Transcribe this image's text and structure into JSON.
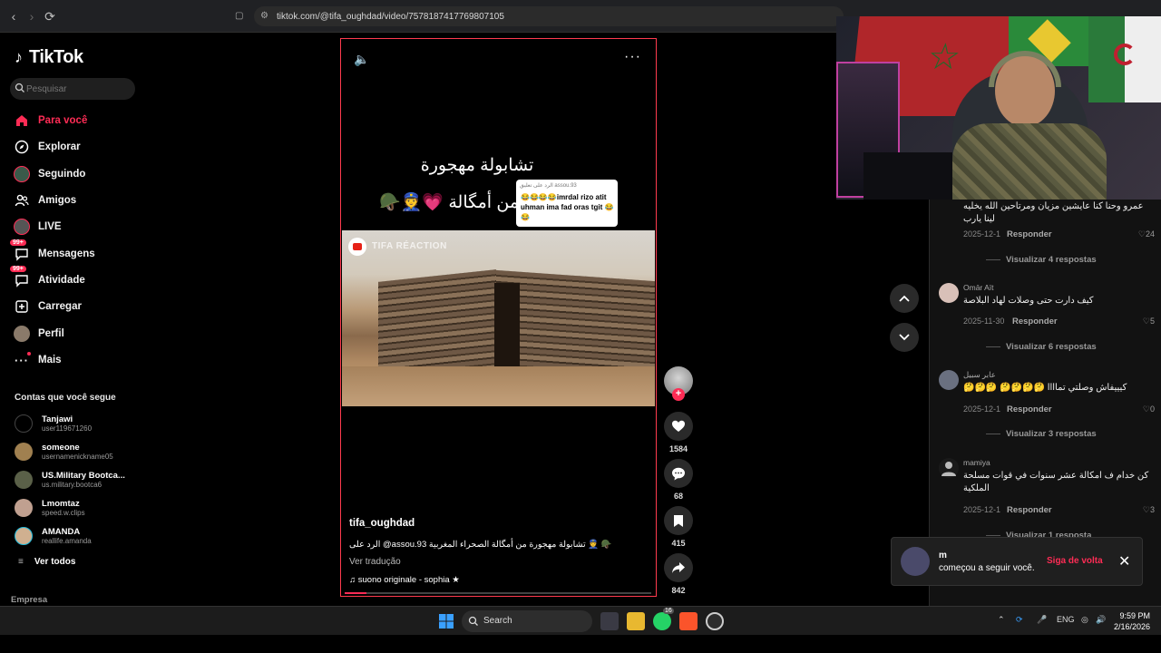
{
  "browser": {
    "url": "tiktok.com/@tifa_oughdad/video/7578187417769807105"
  },
  "sidebar": {
    "logo": "TikTok",
    "search_placeholder": "Pesquisar",
    "nav": [
      {
        "label": "Para você",
        "icon": "home-icon",
        "active": true
      },
      {
        "label": "Explorar",
        "icon": "compass-icon"
      },
      {
        "label": "Seguindo",
        "icon": "following-avatar-icon"
      },
      {
        "label": "Amigos",
        "icon": "friends-icon"
      },
      {
        "label": "LIVE",
        "icon": "live-icon"
      },
      {
        "label": "Mensagens",
        "icon": "messages-icon",
        "badge": "99+"
      },
      {
        "label": "Atividade",
        "icon": "activity-icon",
        "badge": "99+"
      },
      {
        "label": "Carregar",
        "icon": "upload-icon"
      },
      {
        "label": "Perfil",
        "icon": "profile-icon"
      },
      {
        "label": "Mais",
        "icon": "more-dots-icon"
      }
    ],
    "following_heading": "Contas que você segue",
    "following": [
      {
        "name": "Tanjawi",
        "username": "user119671260"
      },
      {
        "name": "someone",
        "username": "usernamenickname05"
      },
      {
        "name": "US.Military Bootca...",
        "username": "us.military.bootca6"
      },
      {
        "name": "Lmomtaz",
        "username": "speed.w.clips"
      },
      {
        "name": "AMANDA",
        "username": "reallife.amanda"
      }
    ],
    "see_all": "Ver todos",
    "footer": "Empresa"
  },
  "video": {
    "overlay_title": "تشابولة مهجورة",
    "overlay_sub": "من أمگالة 💗👮🪖",
    "reply_card_header": "الرد على تعليق assou.93",
    "reply_card_text": "😂😂😂😂imrdal rizo atit uhman ima fad oras tgit 😂😂",
    "scene_label": "TIFA RÉACTION",
    "username": "tifa_oughdad",
    "caption": "الرد على @assou.93 تشابولة مهجورة من أمگالة الصحراء المغربية 👮 🪖",
    "translate": "Ver tradução",
    "music": "suono originale - sophia ★",
    "progress": 0.07
  },
  "actions": {
    "likes": "1584",
    "comments": "68",
    "saves": "415",
    "shares": "842"
  },
  "comments": [
    {
      "name": "",
      "text": "عمرو وحنا كنا عايشين مزيان ومرتاحين الله يخليه لينا يارب",
      "date": "2025-12-1",
      "reply": "Responder",
      "likes": "24",
      "view": "Visualizar 4 respostas"
    },
    {
      "name": "Omār Aït",
      "text": "كيف دارت حتى وصلات لهاد البلاصة",
      "date": "2025-11-30",
      "reply": "Responder",
      "likes": "5",
      "view": "Visualizar 6 respostas"
    },
    {
      "name": "عابر سبيل",
      "text": "كيييفاش وصلتي تماااا 🤔🤔🤔🤔 🤔🤔🤔",
      "date": "2025-12-1",
      "reply": "Responder",
      "likes": "0",
      "view": "Visualizar 3 respostas"
    },
    {
      "name": "mamiya",
      "text": "كن خدام ف امكالة عشر سنوات في قوات مسلحة الملكية",
      "date": "2025-12-1",
      "reply": "Responder",
      "likes": "3",
      "view": "Visualizar 1 resposta"
    }
  ],
  "toast": {
    "name": "m",
    "text": "começou a seguir você.",
    "button": "Siga de volta"
  },
  "taskbar": {
    "search": "Search",
    "whatsapp_badge": "16",
    "lang": "ENG",
    "time": "9:59 PM",
    "date": "2/16/2026"
  }
}
